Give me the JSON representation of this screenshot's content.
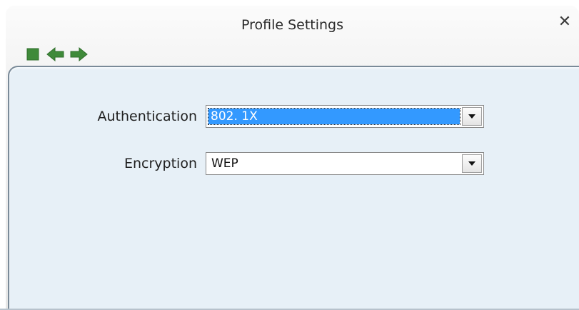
{
  "window": {
    "title": "Profile Settings"
  },
  "toolbar": {
    "buttons": [
      {
        "icon": "stop-icon"
      },
      {
        "icon": "arrow-left-icon"
      },
      {
        "icon": "arrow-right-icon"
      }
    ],
    "accent_color": "#3f8a3a"
  },
  "form": {
    "authentication": {
      "label": "Authentication",
      "value": "802. 1X"
    },
    "encryption": {
      "label": "Encryption",
      "value": "WEP"
    }
  },
  "colors": {
    "panel_background": "#e7f0f7",
    "selection_highlight": "#3399ff"
  }
}
